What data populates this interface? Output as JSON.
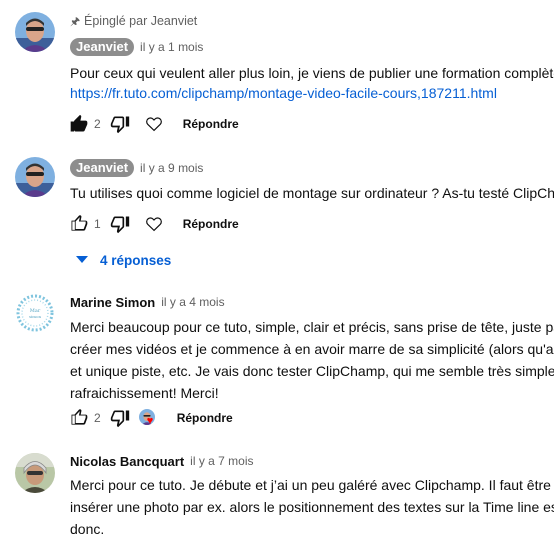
{
  "comments": [
    {
      "pinned_label": "Épinglé par Jeanviet",
      "author": "Jeanviet",
      "time": "il y a 1 mois",
      "text_line1": "Pour ceux qui veulent aller plus loin, je viens de publier une formation complète",
      "link": "https://fr.tuto.com/clipchamp/montage-video-facile-cours,187211.html",
      "likes": "2",
      "reply_label": "Répondre"
    },
    {
      "author": "Jeanviet",
      "time": "il y a 9 mois",
      "text_line1": "Tu utilises quoi comme logiciel de montage sur ordinateur ?  As-tu testé ClipCh",
      "likes": "1",
      "reply_label": "Répondre",
      "replies_label": "4 réponses"
    },
    {
      "author": "Marine Simon",
      "time": "il y a 4 mois",
      "text_lines": [
        "Merci beaucoup pour ce tuto, simple, clair et précis, sans prise de tête, juste pa",
        "créer mes vidéos et je commence à en avoir marre de sa simplicité (alors qu'au",
        "et unique piste, etc. Je vais donc tester ClipChamp, qui me semble très simple",
        "rafraichissement! Merci!"
      ],
      "likes": "2",
      "reply_label": "Répondre",
      "creator_heart_icon": "creator-heart-icon"
    },
    {
      "author": "Nicolas Bancquart",
      "time": "il y a 7 mois",
      "text_lines": [
        "Merci pour ce tuto. Je débute et j’ai un peu galéré avec Clipchamp. Il faut être r",
        "insérer une photo par ex. alors le positionnement des textes sur la Time line es",
        "donc."
      ]
    }
  ],
  "colors": {
    "link": "#065fd4",
    "author_chip": "#8d8d8d",
    "secondary_text": "#606060",
    "heart": "#ff0000"
  },
  "icons": [
    "pin-icon",
    "thumb-up-icon",
    "thumb-down-icon",
    "heart-outline-icon",
    "chevron-down-icon",
    "creator-heart-icon"
  ]
}
